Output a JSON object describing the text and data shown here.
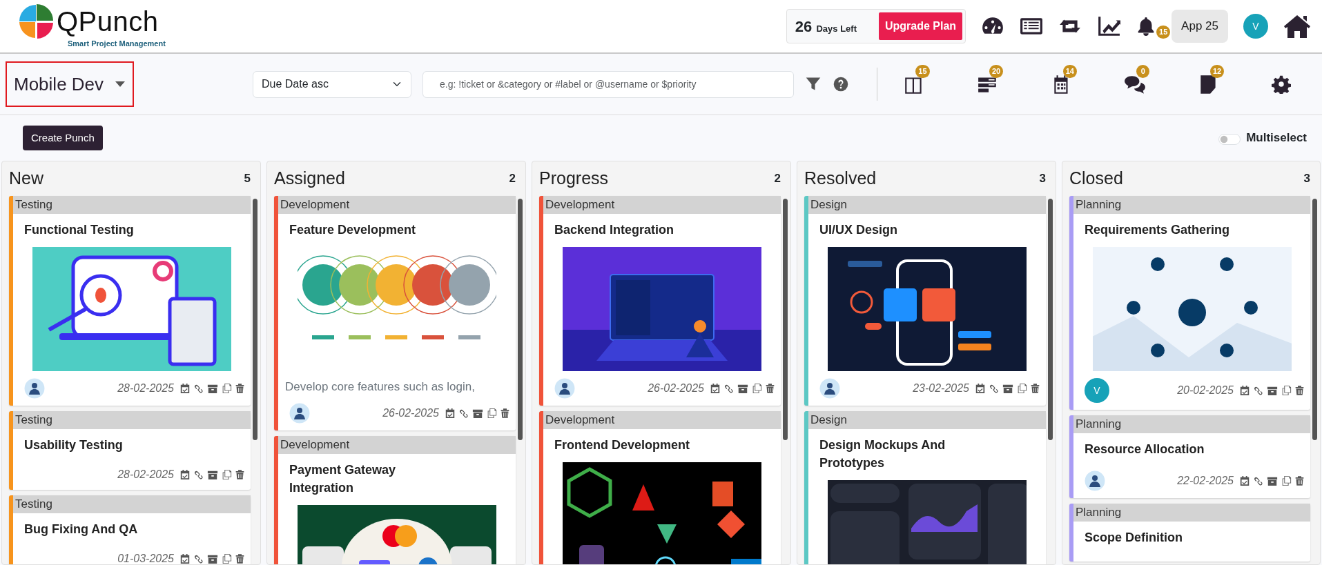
{
  "header": {
    "logo": {
      "name": "QPunch",
      "tagline": "Smart Project Management"
    },
    "trial": {
      "days": "26",
      "label": "Days Left",
      "button": "Upgrade Plan"
    },
    "notifications_badge": "15",
    "app_button": "App 25",
    "user_initial": "V"
  },
  "toolbar": {
    "project": "Mobile Dev",
    "sort": "Due Date asc",
    "search": {
      "placeholder": "e.g: !ticket or &category or #label or @username or $priority"
    },
    "views": [
      {
        "kind": "board",
        "badge": "15"
      },
      {
        "kind": "list",
        "badge": "20"
      },
      {
        "kind": "calendar",
        "badge": "14"
      },
      {
        "kind": "chat",
        "badge": "0"
      },
      {
        "kind": "notes",
        "badge": "12"
      }
    ]
  },
  "actions": {
    "create_button": "Create Punch",
    "multiselect": {
      "label": "Multiselect",
      "on": false
    }
  },
  "columns": [
    {
      "title": "New",
      "count": "5",
      "cards": [
        {
          "category": "Testing",
          "color": "#f7941d",
          "title": "Functional Testing",
          "date": "28-02-2025"
        },
        {
          "category": "Testing",
          "color": "#f7941d",
          "title": "Usability Testing",
          "date": "28-02-2025"
        },
        {
          "category": "Testing",
          "color": "#f7941d",
          "title": "Bug Fixing And QA",
          "date": "01-03-2025"
        }
      ]
    },
    {
      "title": "Assigned",
      "count": "2",
      "cards": [
        {
          "category": "Development",
          "color": "#f0533a",
          "title": "Feature Development",
          "description": "Develop core features such as login,",
          "date": "26-02-2025"
        },
        {
          "category": "Development",
          "color": "#f0533a",
          "title": "Payment Gateway Integration"
        }
      ]
    },
    {
      "title": "Progress",
      "count": "2",
      "cards": [
        {
          "category": "Development",
          "color": "#f0533a",
          "title": "Backend Integration",
          "date": "26-02-2025"
        },
        {
          "category": "Development",
          "color": "#f0533a",
          "title": "Frontend Development"
        }
      ]
    },
    {
      "title": "Resolved",
      "count": "3",
      "cards": [
        {
          "category": "Design",
          "color": "#5cc8c4",
          "title": "UI/UX Design",
          "date": "23-02-2025"
        },
        {
          "category": "Design",
          "color": "#5cc8c4",
          "title": "Design Mockups And Prototypes"
        }
      ]
    },
    {
      "title": "Closed",
      "count": "3",
      "cards": [
        {
          "category": "Planning",
          "color": "#a99cf5",
          "title": "Requirements Gathering",
          "assignee": {
            "kind": "initial",
            "initial": "V"
          },
          "date": "20-02-2025"
        },
        {
          "category": "Planning",
          "color": "#a99cf5",
          "title": "Resource Allocation",
          "date": "22-02-2025"
        },
        {
          "category": "Planning",
          "color": "#a99cf5",
          "title": "Scope Definition"
        }
      ]
    }
  ]
}
